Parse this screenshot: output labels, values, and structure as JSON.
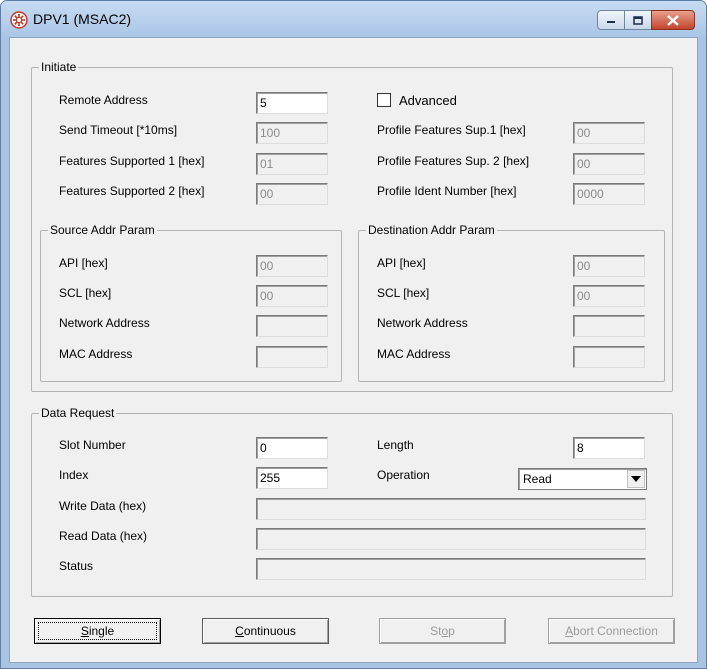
{
  "window": {
    "title": "DPV1 (MSAC2)",
    "icon": "gear-icon",
    "controls": {
      "minimize": "minimize-icon",
      "maximize": "maximize-icon",
      "close": "close-icon"
    }
  },
  "initiate": {
    "title": "Initiate",
    "remote_address": {
      "label": "Remote Address",
      "value": "5"
    },
    "send_timeout": {
      "label": "Send Timeout [*10ms]",
      "value": "100"
    },
    "features_supported_1": {
      "label": "Features Supported 1 [hex]",
      "value": "01"
    },
    "features_supported_2": {
      "label": "Features Supported 2 [hex]",
      "value": "00"
    },
    "advanced": {
      "label": "Advanced",
      "checked": false
    },
    "profile_features_sup_1": {
      "label": "Profile Features Sup.1 [hex]",
      "value": "00"
    },
    "profile_features_sup_2": {
      "label": "Profile Features Sup. 2 [hex]",
      "value": "00"
    },
    "profile_ident_number": {
      "label": "Profile Ident Number [hex]",
      "value": "0000"
    },
    "source": {
      "title": "Source Addr Param",
      "api": {
        "label": "API [hex]",
        "value": "00"
      },
      "scl": {
        "label": "SCL [hex]",
        "value": "00"
      },
      "network_address": {
        "label": "Network Address",
        "value": ""
      },
      "mac_address": {
        "label": "MAC Address",
        "value": ""
      }
    },
    "destination": {
      "title": "Destination Addr Param",
      "api": {
        "label": "API [hex]",
        "value": "00"
      },
      "scl": {
        "label": "SCL [hex]",
        "value": "00"
      },
      "network_address": {
        "label": "Network Address",
        "value": ""
      },
      "mac_address": {
        "label": "MAC Address",
        "value": ""
      }
    }
  },
  "data_request": {
    "title": "Data Request",
    "slot_number": {
      "label": "Slot Number",
      "value": "0"
    },
    "index": {
      "label": "Index",
      "value": "255"
    },
    "length": {
      "label": "Length",
      "value": "8"
    },
    "operation": {
      "label": "Operation",
      "value": "Read"
    },
    "write_data": {
      "label": "Write Data (hex)",
      "value": ""
    },
    "read_data": {
      "label": "Read Data (hex)",
      "value": ""
    },
    "status": {
      "label": "Status",
      "value": ""
    }
  },
  "buttons": {
    "single": {
      "pre": "",
      "key": "S",
      "post": "ingle"
    },
    "continuous": {
      "pre": "",
      "key": "C",
      "post": "ontinuous"
    },
    "stop": {
      "pre": "St",
      "key": "o",
      "post": "p"
    },
    "abort": {
      "pre": "",
      "key": "A",
      "post": "bort Connection"
    }
  }
}
